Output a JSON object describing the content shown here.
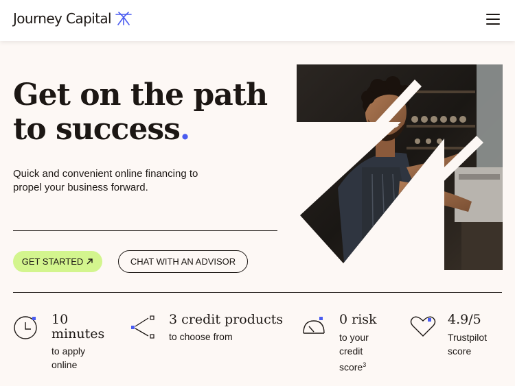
{
  "header": {
    "brand": "Journey Capital",
    "logo_icon": "journey-starburst-icon",
    "menu_icon": "hamburger-menu-icon"
  },
  "hero": {
    "headline_main": "Get on the path to success",
    "headline_dot": ".",
    "subline": "Quick and convenient online financing to propel your business forward.",
    "primary_cta": "GET STARTED",
    "primary_cta_icon": "arrow-up-right-icon",
    "secondary_cta": "CHAT WITH AN ADVISOR",
    "image_description_icon": "barista-photo"
  },
  "stats": [
    {
      "icon": "clock-icon",
      "value": "10 minutes",
      "desc": "to apply online",
      "sup": ""
    },
    {
      "icon": "branching-nodes-icon",
      "value": "3 credit products",
      "desc": "to choose from",
      "sup": ""
    },
    {
      "icon": "gauge-icon",
      "value": "0 risk",
      "desc": "to your credit score",
      "sup": "3"
    },
    {
      "icon": "heart-icon",
      "value": "4.9/5",
      "desc": "Trustpilot score",
      "sup": ""
    }
  ],
  "colors": {
    "accent_blue": "#4a5cf0",
    "cta_green": "#d3f58e",
    "background": "#fdf8f5"
  }
}
